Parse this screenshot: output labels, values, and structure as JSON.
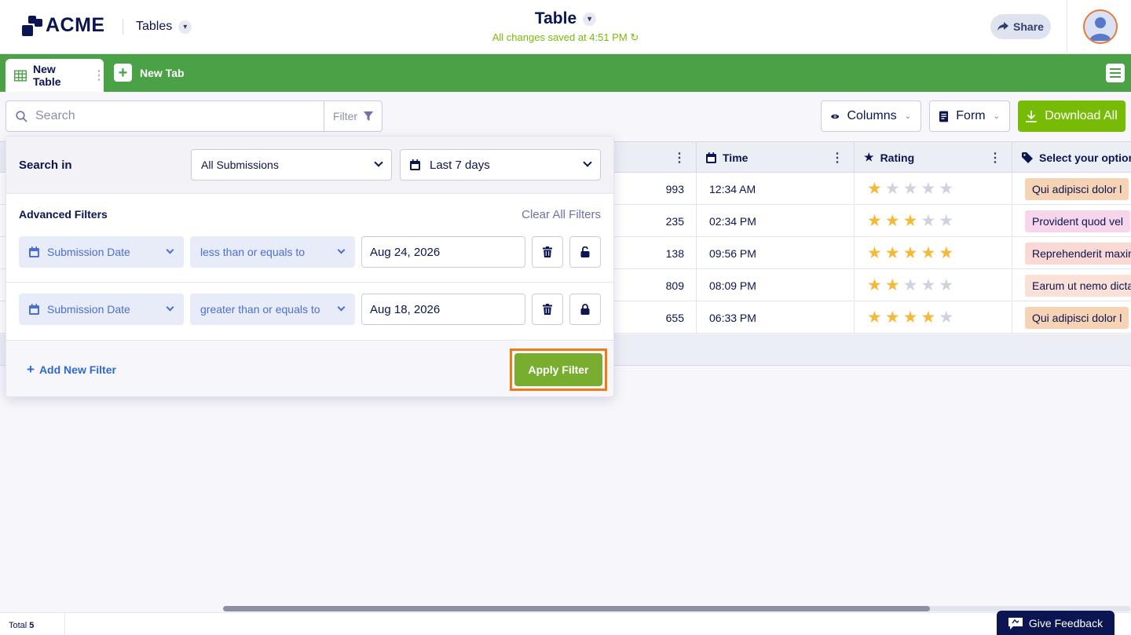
{
  "header": {
    "logo_text": "ACME",
    "nav_label": "Tables",
    "title": "Table",
    "saved_status": "All changes saved at 4:51 PM",
    "share_label": "Share"
  },
  "tabs": {
    "active_label": "New Table",
    "new_tab_label": "New Tab"
  },
  "toolbar": {
    "search_placeholder": "Search",
    "filter_label": "Filter",
    "columns_label": "Columns",
    "form_label": "Form",
    "download_label": "Download All"
  },
  "table": {
    "columns": [
      "Time",
      "Rating",
      "Select your option"
    ],
    "rows": [
      {
        "num": "993",
        "time": "12:34 AM",
        "rating": 1,
        "option": "Qui adipisci dolor l",
        "tag_color": "#f7d3b5"
      },
      {
        "num": "235",
        "time": "02:34 PM",
        "rating": 3,
        "option": "Provident quod vel",
        "tag_color": "#f7d5ea"
      },
      {
        "num": "138",
        "time": "09:56 PM",
        "rating": 5,
        "option": "Reprehenderit maxim",
        "tag_color": "#fad9d5"
      },
      {
        "num": "809",
        "time": "08:09 PM",
        "rating": 2,
        "option": "Earum ut nemo dicta",
        "tag_color": "#fbe0d8"
      },
      {
        "num": "655",
        "time": "06:33 PM",
        "rating": 4,
        "option": "Qui adipisci dolor l",
        "tag_color": "#f7d3b5"
      }
    ],
    "max_rating": 5
  },
  "filter_panel": {
    "search_in_label": "Search in",
    "scope_value": "All Submissions",
    "range_value": "Last 7 days",
    "advanced_label": "Advanced Filters",
    "clear_all_label": "Clear All Filters",
    "filters": [
      {
        "field": "Submission Date",
        "operator": "less than or equals to",
        "value": "Aug 24, 2026"
      },
      {
        "field": "Submission Date",
        "operator": "greater than or equals to",
        "value": "Aug 18, 2026"
      }
    ],
    "add_filter_label": "Add New Filter",
    "apply_label": "Apply Filter"
  },
  "footer": {
    "total_label": "Total",
    "total_count": "5",
    "feedback_label": "Give Feedback"
  },
  "colors": {
    "brand_green": "#4aa146",
    "accent_green": "#78bb07",
    "navy": "#0a1551",
    "highlight_orange": "#f07a15"
  }
}
